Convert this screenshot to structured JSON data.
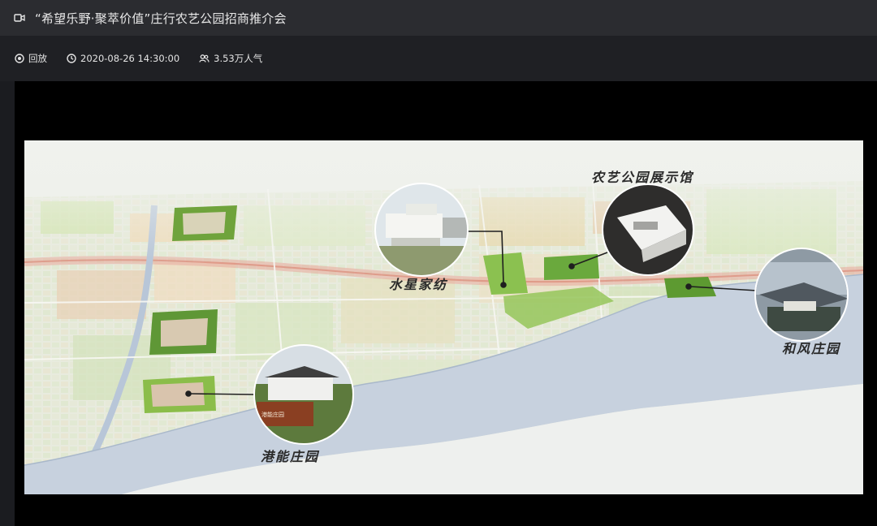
{
  "window": {
    "title": "“希望乐野·聚萃价值”庄行农艺公园招商推介会",
    "title_icon": "video-camera-icon"
  },
  "meta": {
    "status_label": "回放",
    "status_icon": "playback-icon",
    "datetime": "2020-08-26 14:30:00",
    "datetime_icon": "clock-icon",
    "popularity": "3.53万人气",
    "popularity_icon": "users-icon"
  },
  "map": {
    "labels": {
      "shuixing": "水星家纺",
      "exhibition": "农艺公园展示馆",
      "hefeng": "和风庄园",
      "gangneng": "港能庄园"
    },
    "sign_text": "港能庄园",
    "colors": {
      "frame_bg": "#000000",
      "river": "#c9d3e0",
      "greenery": "#7fb84a",
      "land": "#e7eadf"
    }
  }
}
